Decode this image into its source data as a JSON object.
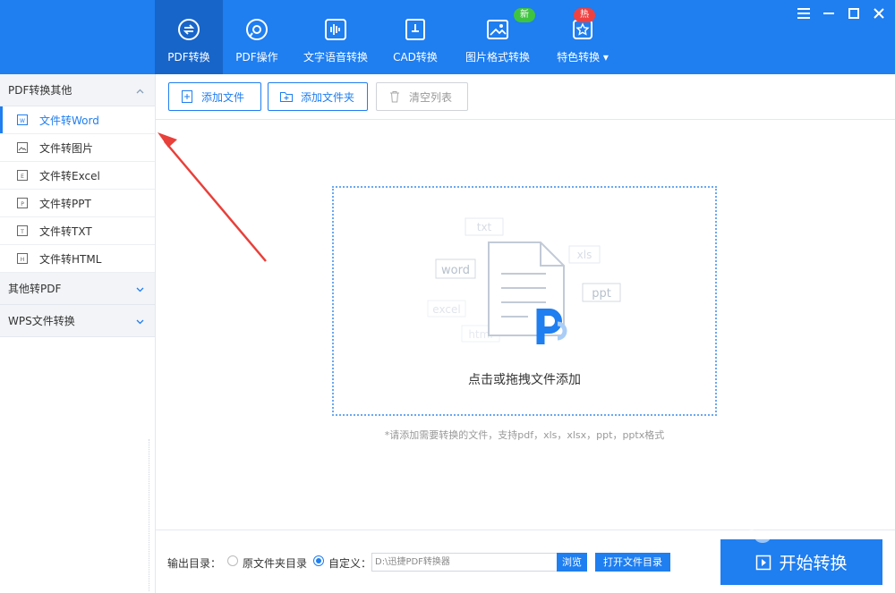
{
  "nav": {
    "tabs": [
      {
        "label": "PDF转换",
        "icon": "pdf-convert-icon",
        "active": true
      },
      {
        "label": "PDF操作",
        "icon": "pdf-operate-icon"
      },
      {
        "label": "文字语音转换",
        "icon": "voice-wave-icon"
      },
      {
        "label": "CAD转换",
        "icon": "cad-icon"
      },
      {
        "label": "图片格式转换",
        "icon": "image-icon",
        "badge": "新"
      },
      {
        "label": "特色转换",
        "icon": "feature-icon",
        "badge": "热",
        "dropdown": true
      }
    ]
  },
  "sidebar": {
    "groups": [
      {
        "label": "PDF转换其他",
        "expanded": true,
        "items": [
          {
            "label": "文件转Word",
            "icon": "W",
            "active": true
          },
          {
            "label": "文件转图片",
            "icon": "image"
          },
          {
            "label": "文件转Excel",
            "icon": "E"
          },
          {
            "label": "文件转PPT",
            "icon": "P"
          },
          {
            "label": "文件转TXT",
            "icon": "T"
          },
          {
            "label": "文件转HTML",
            "icon": "H"
          }
        ]
      },
      {
        "label": "其他转PDF",
        "expanded": false
      },
      {
        "label": "WPS文件转换",
        "expanded": false
      }
    ]
  },
  "toolbar": {
    "add_file": "添加文件",
    "add_folder": "添加文件夹",
    "clear_list": "清空列表"
  },
  "dropzone": {
    "text": "点击或拖拽文件添加",
    "formats": [
      "txt",
      "xls",
      "word",
      "ppt",
      "excel",
      "html"
    ]
  },
  "hint": "*请添加需要转换的文件，支持pdf，xls，xlsx，ppt，pptx格式",
  "output": {
    "label": "输出目录：",
    "option_original": "原文件夹目录",
    "option_custom": "自定义：",
    "selected": "custom",
    "path": "D:\\迅捷PDF转换器",
    "browse": "浏览",
    "open_folder": "打开文件目录"
  },
  "start_button": "开始转换",
  "colors": {
    "brand": "#1f7ef0",
    "brand_dark": "#1765c9",
    "badge_new": "#3fc43f",
    "badge_hot": "#f04141",
    "annotation": "#e8403a"
  }
}
